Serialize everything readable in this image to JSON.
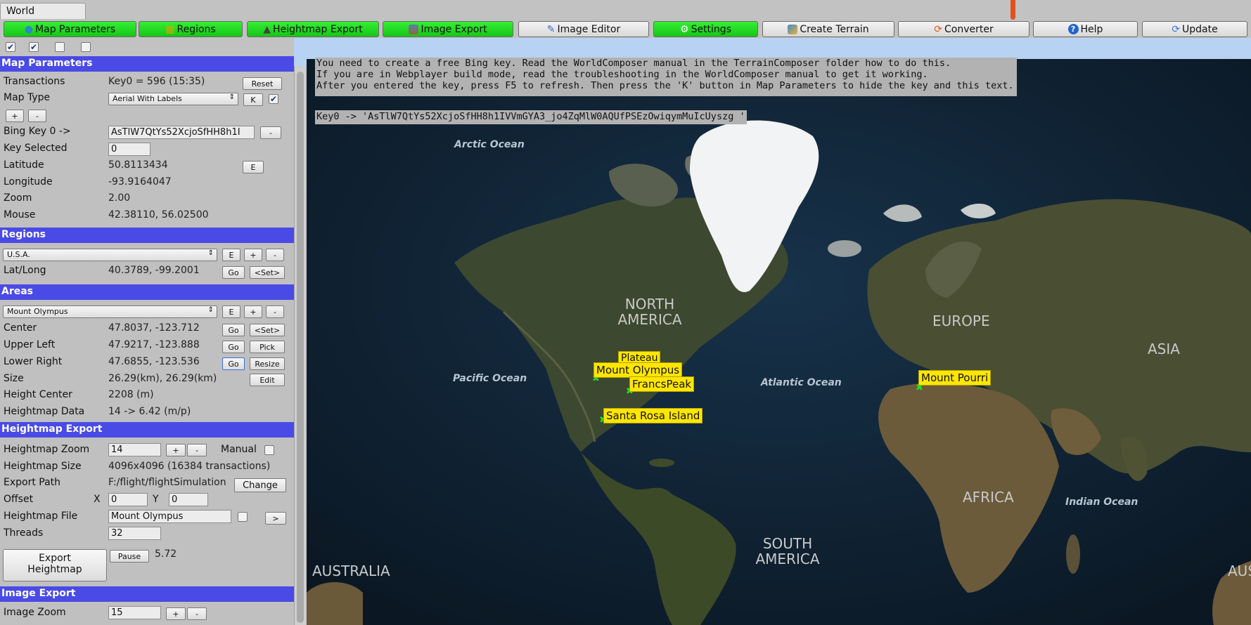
{
  "window": {
    "tab": "World"
  },
  "toolbar": {
    "buttons": [
      {
        "label": "Map Parameters",
        "icon": "pin-icon"
      },
      {
        "label": "Regions",
        "icon": "grid-icon"
      },
      {
        "label": "Heightmap Export",
        "icon": "terrain-icon"
      },
      {
        "label": "Image Export",
        "icon": "image-icon"
      },
      {
        "label": "Image Editor",
        "icon": "pencil-icon"
      },
      {
        "label": "Settings",
        "icon": "gear-icon"
      },
      {
        "label": "Create Terrain",
        "icon": "terrain-grid-icon"
      },
      {
        "label": "Converter",
        "icon": "convert-icon"
      },
      {
        "label": "Help",
        "icon": "help-icon"
      },
      {
        "label": "Update",
        "icon": "refresh-icon"
      }
    ],
    "checkboxes": [
      true,
      true,
      false,
      false
    ]
  },
  "map_parameters": {
    "title": "Map Parameters",
    "transactions_label": "Transactions",
    "transactions_value": "Key0 = 596 (15:35)",
    "reset": "Reset",
    "map_type_label": "Map Type",
    "map_type_value": "Aerial With Labels",
    "k_button": "K",
    "k_checked": true,
    "plus": "+",
    "minus": "-",
    "bing_label": "Bing Key 0 ->",
    "bing_value": "AsTlW7QtYs52XcjoSfHH8h1I",
    "bing_minus": "-",
    "key_selected_label": "Key Selected",
    "key_selected_value": "0",
    "latitude_label": "Latitude",
    "latitude_value": "50.8113434",
    "e_button": "E",
    "longitude_label": "Longitude",
    "longitude_value": "-93.9164047",
    "zoom_label": "Zoom",
    "zoom_value": "2.00",
    "mouse_label": "Mouse",
    "mouse_value": "42.38110, 56.02500"
  },
  "regions": {
    "title": "Regions",
    "selected": "U.S.A.",
    "e": "E",
    "plus": "+",
    "minus": "-",
    "latlong_label": "Lat/Long",
    "latlong_value": "40.3789, -99.2001",
    "go": "Go",
    "set": "<Set>"
  },
  "areas": {
    "title": "Areas",
    "selected": "Mount Olympus",
    "e": "E",
    "plus": "+",
    "minus": "-",
    "center_label": "Center",
    "center_value": "47.8037, -123.712",
    "go": "Go",
    "set": "<Set>",
    "upper_left_label": "Upper Left",
    "upper_left_value": "47.9217, -123.888",
    "pick": "Pick",
    "lower_right_label": "Lower Right",
    "lower_right_value": "47.6855, -123.536",
    "resize": "Resize",
    "size_label": "Size",
    "size_value": "26.29(km), 26.29(km)",
    "edit": "Edit",
    "height_center_label": "Height Center",
    "height_center_value": "2208 (m)",
    "heightmap_data_label": "Heightmap Data",
    "heightmap_data_value": "14 -> 6.42 (m/p)"
  },
  "heightmap_export": {
    "title": "Heightmap Export",
    "zoom_label": "Heightmap Zoom",
    "zoom_value": "14",
    "plus": "+",
    "minus": "-",
    "manual_label": "Manual",
    "manual_checked": false,
    "size_label": "Heightmap Size",
    "size_value": "4096x4096  (16384 transactions)",
    "path_label": "Export Path",
    "path_value": "F:/flight/flightSimulation",
    "change": "Change",
    "offset_label": "Offset",
    "x_label": "X",
    "x_value": "0",
    "y_label": "Y",
    "y_value": "0",
    "file_label": "Heightmap File",
    "file_value": "Mount Olympus",
    "arrow": ">",
    "threads_label": "Threads",
    "threads_value": "32",
    "export_line1": "Export",
    "export_line2": "Heightmap",
    "pause": "Pause",
    "pause_value": "5.72"
  },
  "image_export": {
    "title": "Image Export",
    "zoom_label": "Image Zoom",
    "zoom_value": "15",
    "plus": "+",
    "minus": "-"
  },
  "map": {
    "info_lines": [
      "You need to create a free Bing key. Read the WorldComposer manual in the TerrainComposer folder how to do this.",
      "If you are in Webplayer build mode, read the troubleshooting in the WorldComposer manual to get it working.",
      "After you entered the key, press F5 to refresh. Then press the 'K' button in Map Parameters to hide the key and this text."
    ],
    "key_line": "Key0 -> 'AsTlW7QtYs52XcjoSfHH8h1IVVmGYA3_jo4ZqMlW0AQUfPSEzOwiqymMuIcUyszg '",
    "oceans": [
      "Arctic Ocean",
      "Pacific Ocean",
      "Atlantic Ocean",
      "Indian Ocean"
    ],
    "continents": [
      "NORTH AMERICA",
      "EUROPE",
      "ASIA",
      "AFRICA",
      "SOUTH AMERICA",
      "AUSTRALIA",
      "AUST"
    ],
    "markers": [
      "Mount Olympus",
      "FrancsPeak",
      "Plateau",
      "Santa Rosa Island",
      "Mount Pourri"
    ]
  }
}
